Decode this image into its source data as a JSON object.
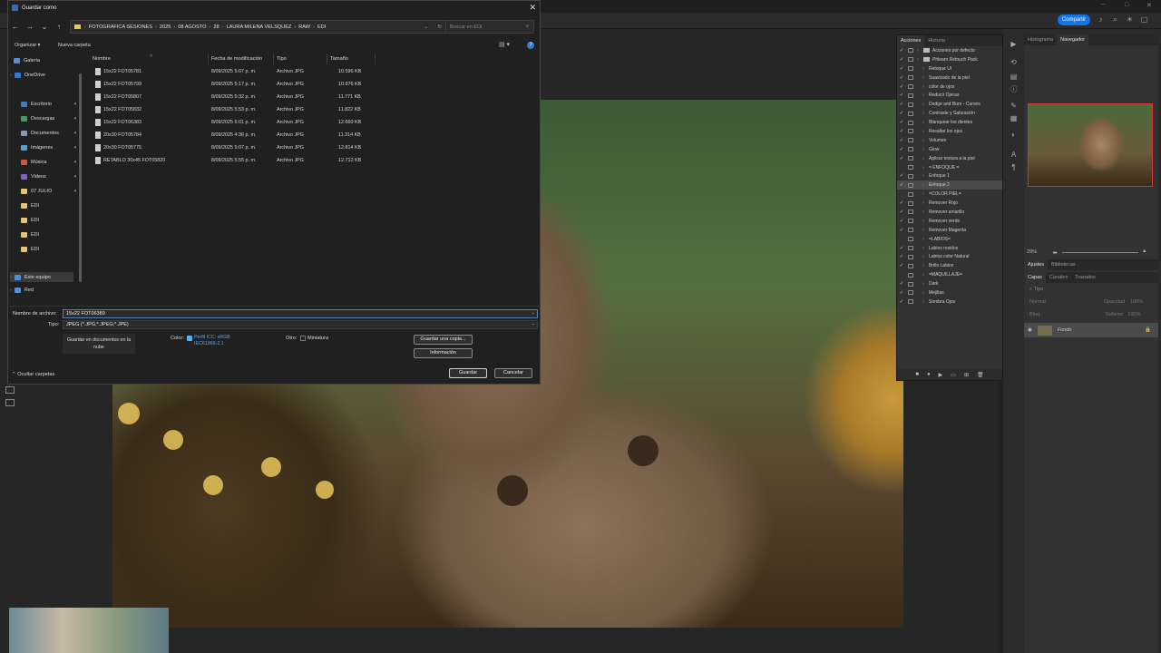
{
  "dialog": {
    "title": "Guardar como",
    "address": [
      "FOTOGRAFICA SESIONES",
      "2025",
      "08 AGOSTO",
      "28",
      "LAURA MILENA VELSQUEZ",
      "RAW",
      "EDI"
    ],
    "search_placeholder": "Buscar en EDI",
    "organize": "Organizar",
    "new_folder": "Nueva carpeta",
    "nav_items": [
      "Galería",
      "OneDrive",
      "Escritorio",
      "Descargas",
      "Documentos",
      "Imágenes",
      "Música",
      "Videos",
      "07 JULIO",
      "EDI",
      "EDI",
      "EDI",
      "EDI",
      "Este equipo",
      "Red"
    ],
    "columns": [
      "Nombre",
      "Fecha de modificación",
      "Tipo",
      "Tamaño"
    ],
    "files": [
      {
        "name": "15x22 FOT05781",
        "date": "8/09/2025 5:07 p. m.",
        "type": "Archivo JPG",
        "size": "10.596 KB"
      },
      {
        "name": "15x22 FOT05799",
        "date": "8/09/2025 5:17 p. m.",
        "type": "Archivo JPG",
        "size": "10.976 KB"
      },
      {
        "name": "15x22 FOT05807",
        "date": "8/09/2025 5:32 p. m.",
        "type": "Archivo JPG",
        "size": "11.771 KB"
      },
      {
        "name": "15x22 FOT05832",
        "date": "8/09/2025 5:53 p. m.",
        "type": "Archivo JPG",
        "size": "11.822 KB"
      },
      {
        "name": "15x22 FOT06383",
        "date": "8/09/2025 6:01 p. m.",
        "type": "Archivo JPG",
        "size": "12.660 KB"
      },
      {
        "name": "20x30 FOT05784",
        "date": "8/09/2025 4:36 p. m.",
        "type": "Archivo JPG",
        "size": "11.314 KB"
      },
      {
        "name": "20x30 FOT05775",
        "date": "8/09/2025 5:07 p. m.",
        "type": "Archivo JPG",
        "size": "12.814 KB"
      },
      {
        "name": "RETABLO 30x45 FOT05820",
        "date": "8/09/2025 5:55 p. m.",
        "type": "Archivo JPG",
        "size": "12.712 KB"
      }
    ],
    "filename_label": "Nombre de archivo:",
    "filename_value": "15x22 FOT06389",
    "type_label": "Tipo:",
    "type_value": "JPEG (*.JPG;*.JPEG;*.JPE)",
    "cloud_save": "Guardar en documentos en la nube",
    "color_label": "Color:",
    "color_value": "Perfil ICC: sRGB IEC61966-2.1",
    "other_label": "Otro:",
    "thumbnail": "Miniatura",
    "save_copy": "Guardar una copia...",
    "info": "Información",
    "save": "Guardar",
    "cancel": "Cancelar",
    "hide_folders": "Ocultar carpetas"
  },
  "ps": {
    "share": "Compartir",
    "actions_tabs": [
      "Acciones",
      "Historia"
    ],
    "actions": [
      {
        "check": true,
        "label": "Acciones por defecto",
        "folder": true
      },
      {
        "check": true,
        "label": "Phlearn Retouch Pack",
        "folder": true
      },
      {
        "check": true,
        "label": "Retoque Ui"
      },
      {
        "check": true,
        "label": "Suavizado de la piel"
      },
      {
        "check": true,
        "label": "color de ojos"
      },
      {
        "check": true,
        "label": "Reducir Ojeras"
      },
      {
        "check": true,
        "label": "Dodge and Burn - Curves"
      },
      {
        "check": true,
        "label": "Contraste y Saturación"
      },
      {
        "check": true,
        "label": "Blanquear los dientes"
      },
      {
        "check": true,
        "label": "Resaltar los ojos"
      },
      {
        "check": true,
        "label": "Volumen"
      },
      {
        "check": true,
        "label": "Glow"
      },
      {
        "check": true,
        "label": "Aplicar textura a la piel"
      },
      {
        "check": false,
        "label": "= ENFOQUE ="
      },
      {
        "check": true,
        "label": "Enfoque 1"
      },
      {
        "check": true,
        "label": "Enfoque 2",
        "selected": true
      },
      {
        "check": false,
        "label": "=COLOR PIEL="
      },
      {
        "check": true,
        "label": "Remover Rojo"
      },
      {
        "check": true,
        "label": "Remover amarillo"
      },
      {
        "check": true,
        "label": "Remover verde"
      },
      {
        "check": true,
        "label": "Remover Magenta"
      },
      {
        "check": false,
        "label": "=LABIOS="
      },
      {
        "check": true,
        "label": "Labios rosidos"
      },
      {
        "check": true,
        "label": "Labios color Natural"
      },
      {
        "check": true,
        "label": "Brillo Labios"
      },
      {
        "check": false,
        "label": "=MAQUILLAJE="
      },
      {
        "check": true,
        "label": "Dark"
      },
      {
        "check": true,
        "label": "Mejillas"
      },
      {
        "check": true,
        "label": "Sombra Ojos"
      }
    ],
    "nav_tabs": [
      "Histograma",
      "Navegador"
    ],
    "zoom": "29%",
    "adj_tabs": [
      "Ajustes",
      "Bibliotecas"
    ],
    "layer_tabs": [
      "Capas",
      "Canales",
      "Trazados"
    ],
    "layer_search": "Tipo",
    "blend_mode": "Normal",
    "opacity_label": "Opacidad:",
    "opacity": "100%",
    "lock_label": "Bloq.:",
    "fill_label": "Relleno:",
    "fill": "100%",
    "layer_name": "Fondo"
  }
}
